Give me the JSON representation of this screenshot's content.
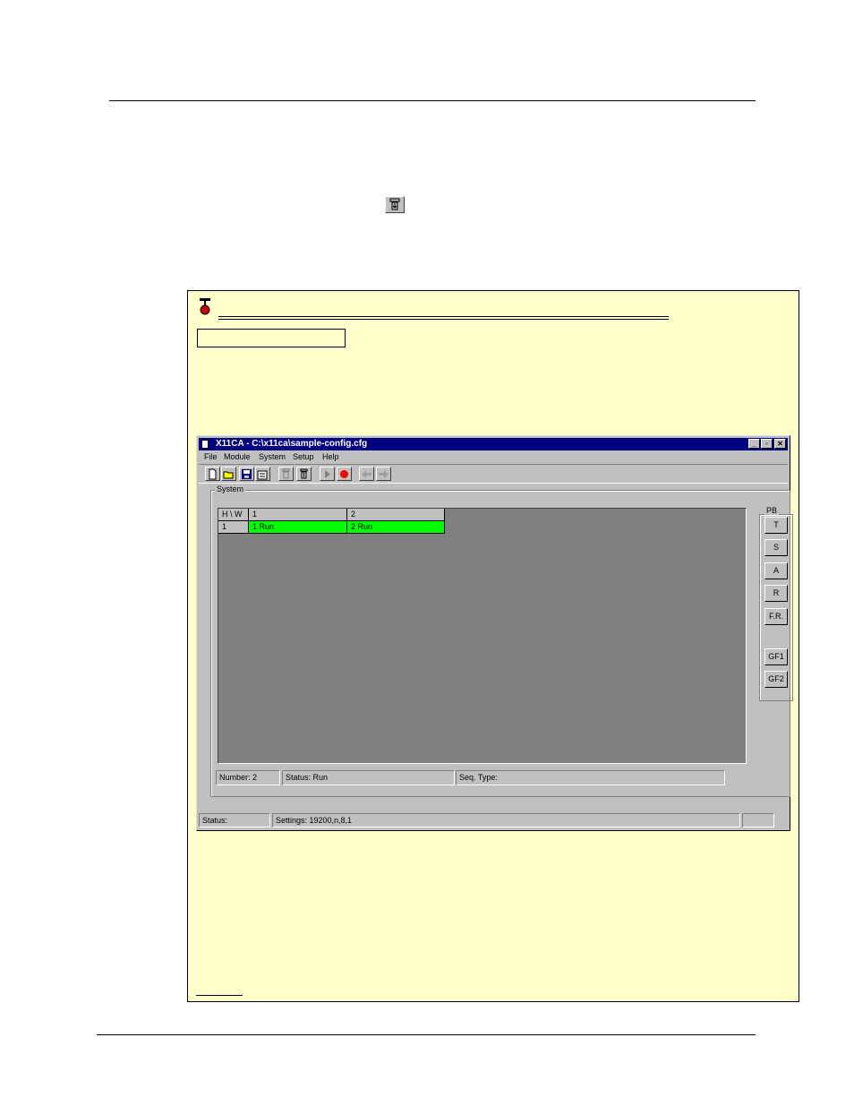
{
  "window": {
    "title": "X11CA - C:\\x11ca\\sample-config.cfg",
    "controls": {
      "minimize": "_",
      "maximize": "▫",
      "close": "✕"
    }
  },
  "menu": {
    "items": [
      {
        "label": "File"
      },
      {
        "label": "Module"
      },
      {
        "label": "System"
      },
      {
        "label": "Setup"
      },
      {
        "label": "Help"
      }
    ]
  },
  "toolbar": {
    "buttons": [
      "new-icon",
      "open-icon",
      "save-icon",
      "properties-icon",
      "download-icon",
      "upload-icon",
      "run-icon",
      "stop-icon",
      "back-icon",
      "forward-icon"
    ]
  },
  "system_group": {
    "label": "System"
  },
  "grid": {
    "corner": "H \\ W",
    "columns": [
      "1",
      "2"
    ],
    "rows": [
      {
        "header": "1",
        "cells": [
          "1 Run",
          "2 Run"
        ]
      }
    ],
    "run_color": "#00ff00"
  },
  "pb_group": {
    "label": "PB",
    "buttons": [
      "T",
      "S",
      "A",
      "R",
      "F.R.",
      "GF1",
      "GF2"
    ]
  },
  "info": {
    "number": "Number: 2",
    "status": "Status: Run",
    "seq_type": "Seq. Type:"
  },
  "statusbar": {
    "status": "Status:",
    "settings": "Settings: 19200,n,8,1"
  },
  "colors": {
    "note_bg": "#ffffcc",
    "title_bg": "#000080",
    "grid_bg": "#808080"
  }
}
